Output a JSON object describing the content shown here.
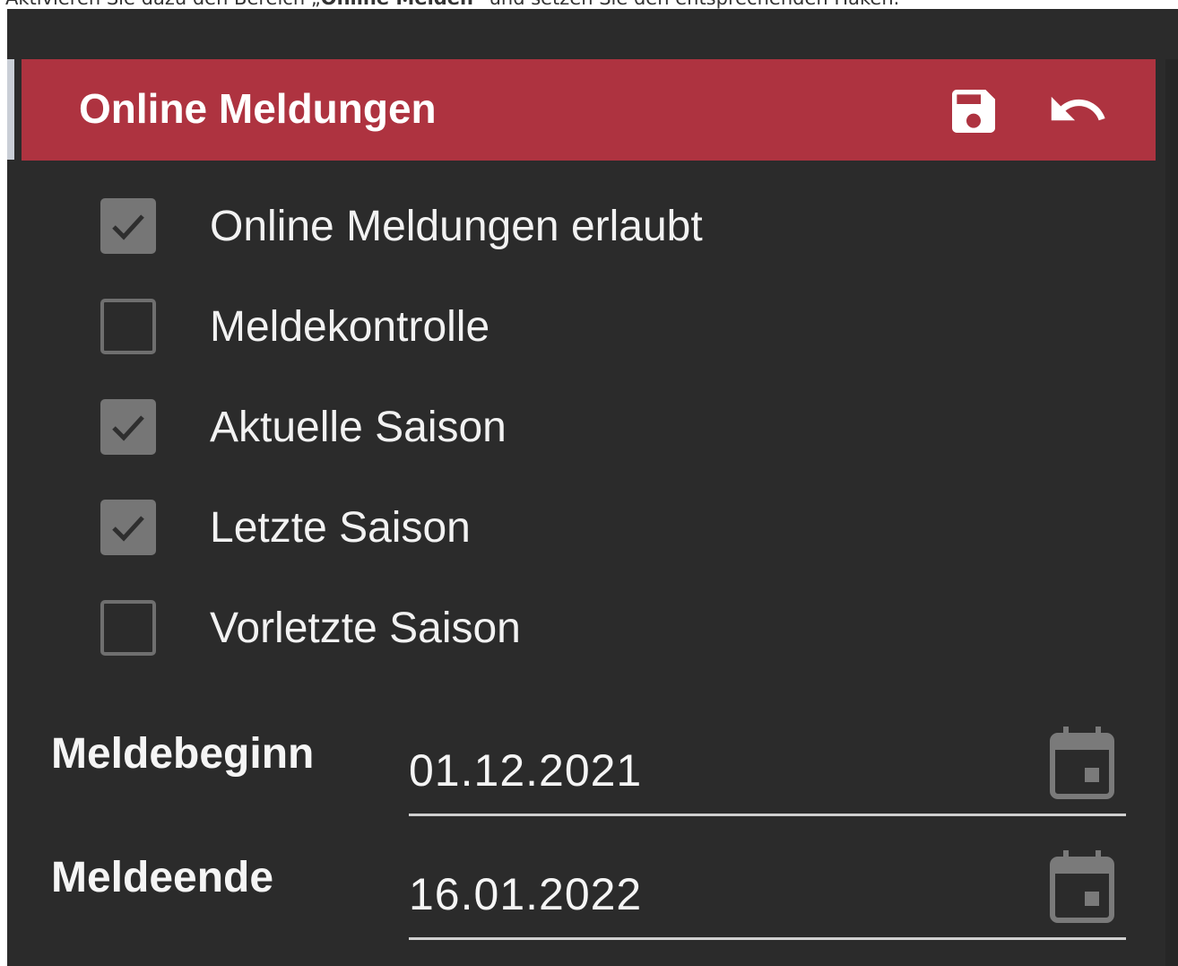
{
  "instruction": {
    "prefix": "Aktivieren Sie dazu den Bereich „",
    "bold": "Online Melden",
    "suffix": "“ und setzen Sie den entsprechenden Haken."
  },
  "header": {
    "title": "Online Meldungen",
    "save_icon": "save-icon",
    "undo_icon": "undo-icon",
    "background": "#ae3340"
  },
  "options": [
    {
      "label": "Online Meldungen erlaubt",
      "checked": true
    },
    {
      "label": "Meldekontrolle",
      "checked": false
    },
    {
      "label": "Aktuelle Saison",
      "checked": true
    },
    {
      "label": "Letzte Saison",
      "checked": true
    },
    {
      "label": "Vorletzte Saison",
      "checked": false
    }
  ],
  "fields": {
    "start": {
      "label": "Meldebeginn",
      "value": "01.12.2021",
      "icon": "calendar-icon"
    },
    "end": {
      "label": "Meldeende",
      "value": "16.01.2022",
      "icon": "calendar-icon"
    }
  }
}
